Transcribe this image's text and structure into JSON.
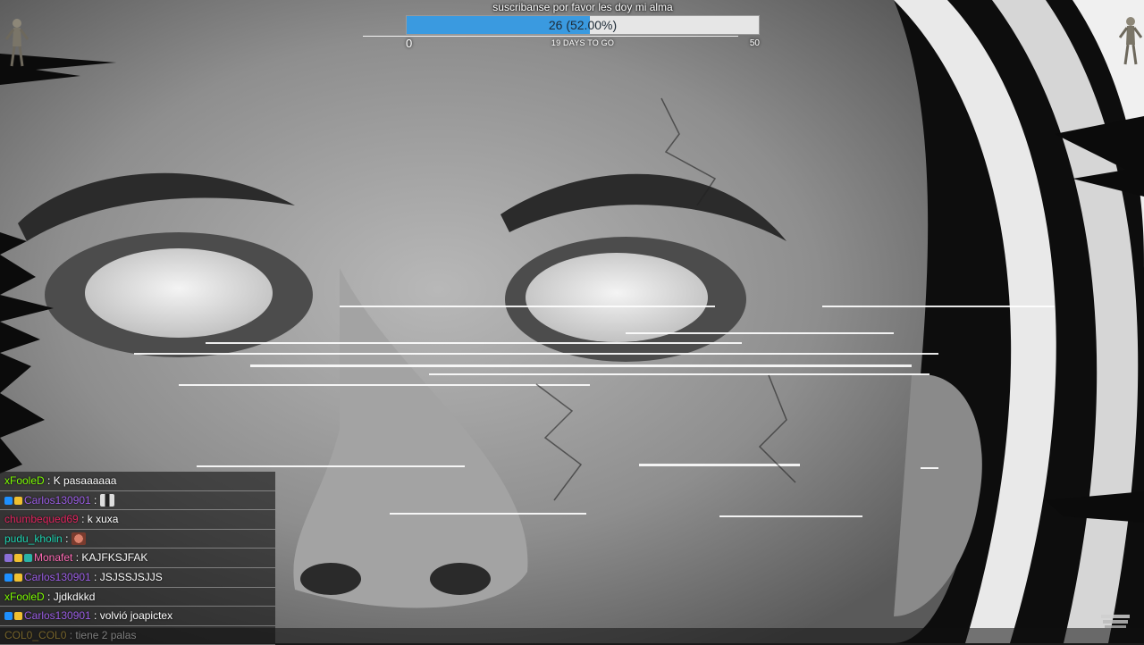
{
  "goal": {
    "title": "suscribanse por favor les doy mi alma",
    "progress_text": "26 (52.00%)",
    "current": 26,
    "target": 50,
    "fraction": 0.52,
    "min_label": "0",
    "max_label": "50",
    "subtitle": "19 DAYS TO GO",
    "fill_color": "#3a9ae0",
    "track_color": "#e6e6e6"
  },
  "chat": {
    "messages": [
      {
        "user": "xFooleD",
        "user_color": "#7cfc00",
        "badges": [],
        "text": "K pasaaaaaa",
        "emote": ""
      },
      {
        "user": "Carlos130901",
        "user_color": "#9b5de5",
        "badges": [
          "#1e90ff",
          "#f0c030"
        ],
        "text": "",
        "emote": "panda-emote"
      },
      {
        "user": "chumbequed69",
        "user_color": "#e0245e",
        "badges": [],
        "text": "k xuxa",
        "emote": ""
      },
      {
        "user": "pudu_kholin",
        "user_color": "#1dd3b0",
        "badges": [],
        "text": "",
        "emote": "face-emote"
      },
      {
        "user": "Monafet",
        "user_color": "#ff69b4",
        "badges": [
          "#8a6fd6",
          "#f0c030",
          "#2ab3a6"
        ],
        "text": "KAJFKSJFAK",
        "emote": ""
      },
      {
        "user": "Carlos130901",
        "user_color": "#9b5de5",
        "badges": [
          "#1e90ff",
          "#f0c030"
        ],
        "text": "JSJSSJSJJS",
        "emote": ""
      },
      {
        "user": "xFooleD",
        "user_color": "#7cfc00",
        "badges": [],
        "text": "Jjdkdkkd",
        "emote": ""
      },
      {
        "user": "Carlos130901",
        "user_color": "#9b5de5",
        "badges": [
          "#1e90ff",
          "#f0c030"
        ],
        "text": "volvió joapictex",
        "emote": ""
      },
      {
        "user": "COL0_COL0",
        "user_color": "#f2c94c",
        "badges": [],
        "text": "tiene 2 palas",
        "emote": ""
      }
    ]
  },
  "icons": {
    "corner_left": "dancing-figure-icon",
    "corner_right": "dancing-figure-icon"
  }
}
